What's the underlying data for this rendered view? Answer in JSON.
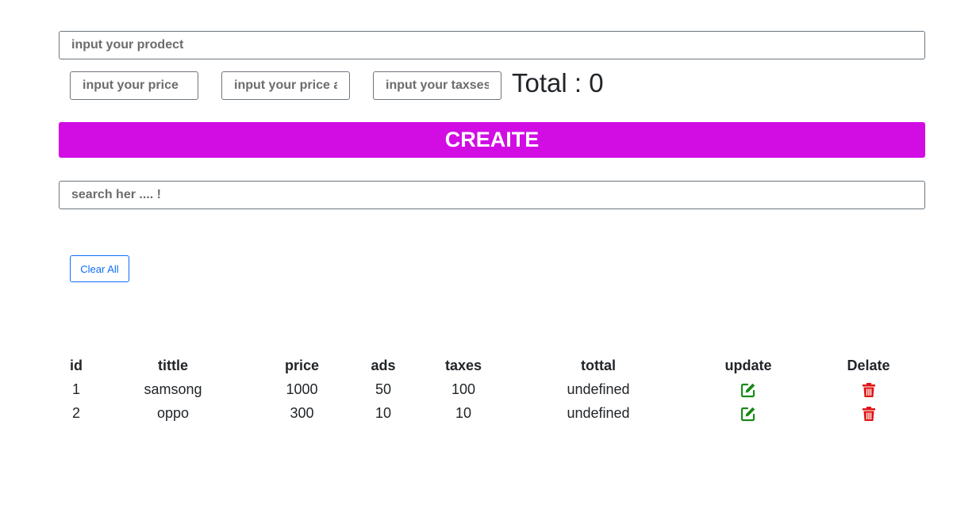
{
  "form": {
    "product_placeholder": "input your prodect",
    "price_placeholder": "input your price",
    "ads_placeholder": "input your price ads",
    "taxes_placeholder": "input your taxses",
    "total_label": "Total : 0"
  },
  "create_button": {
    "label": "CREAITE",
    "color": "#d10de4"
  },
  "search": {
    "placeholder": "search her .... !"
  },
  "clear_button": {
    "label": "Clear All"
  },
  "table": {
    "headers": [
      "id",
      "tittle",
      "price",
      "ads",
      "taxes",
      "tottal",
      "update",
      "Delate"
    ],
    "rows": [
      {
        "id": "1",
        "title": "samsong",
        "price": "1000",
        "ads": "50",
        "taxes": "100",
        "total": "undefined",
        "update_icon": "edit-icon",
        "delete_icon": "trash-icon"
      },
      {
        "id": "2",
        "title": "oppo",
        "price": "300",
        "ads": "10",
        "taxes": "10",
        "total": "undefined",
        "update_icon": "edit-icon",
        "delete_icon": "trash-icon"
      }
    ]
  },
  "colors": {
    "update_icon": "#198a19",
    "delete_icon": "#e01515",
    "clear_button": "#0d6efd"
  }
}
